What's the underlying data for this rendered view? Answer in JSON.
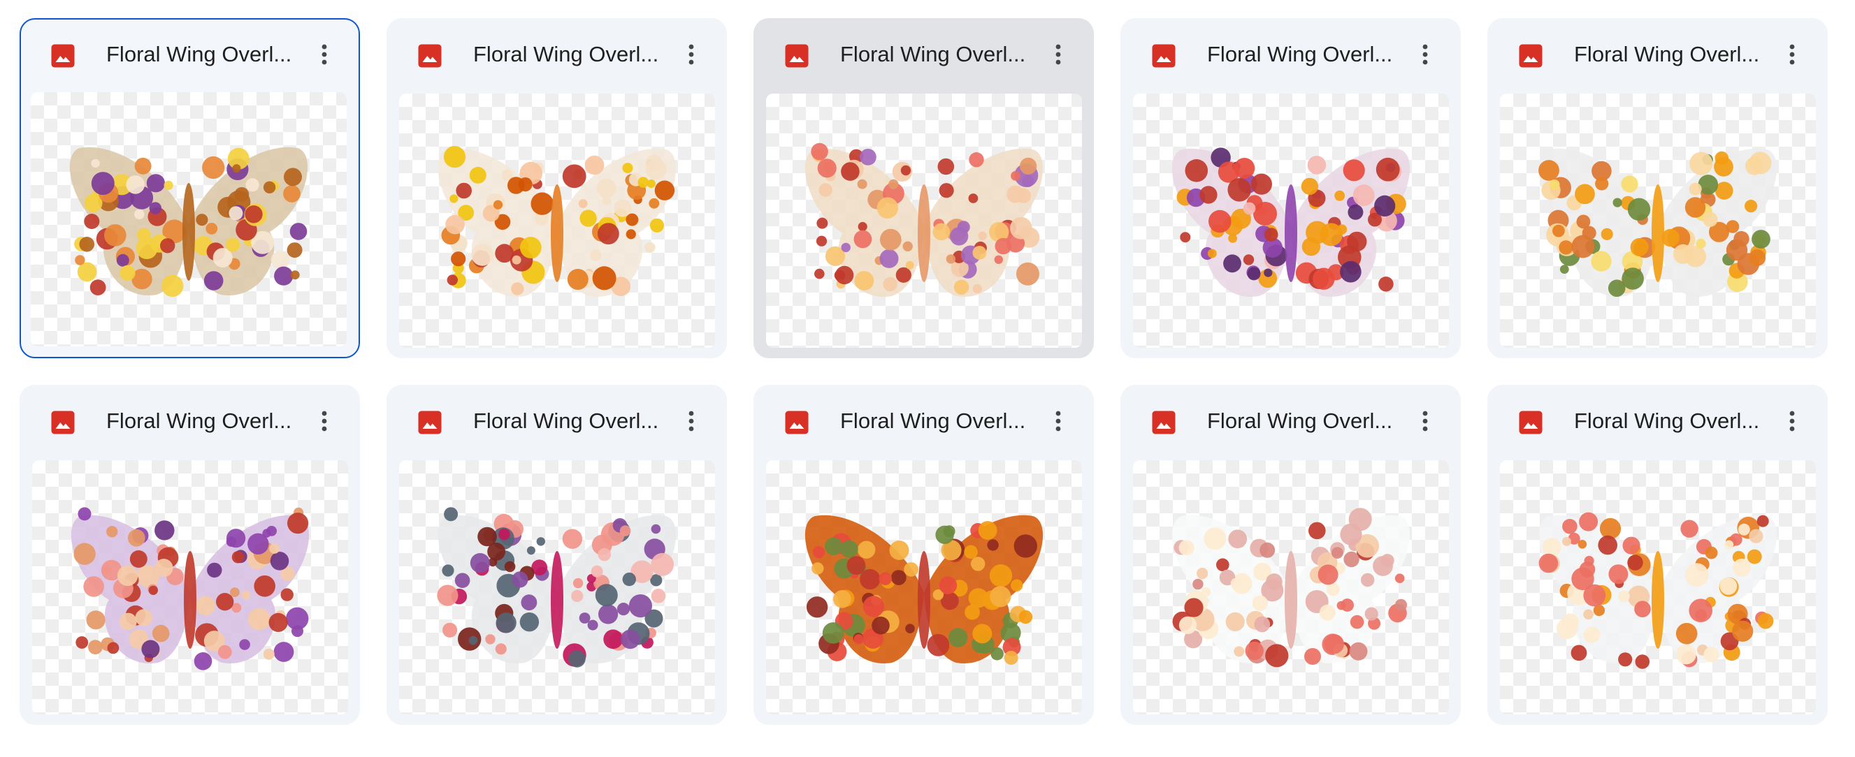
{
  "files": [
    {
      "name": "Floral Wing Overl...",
      "state": "selected",
      "petals": [
        "#b5651d",
        "#e8893a",
        "#c0392b",
        "#f4d03f",
        "#7d3c98",
        "#f5e6d3"
      ],
      "wing_tone": "#d9c6a5"
    },
    {
      "name": "Floral Wing Overl...",
      "state": "normal",
      "petals": [
        "#e67e22",
        "#c0392b",
        "#f7c59f",
        "#f1c40f",
        "#f5e1c8",
        "#d35400"
      ],
      "wing_tone": "#f2e6d8"
    },
    {
      "name": "Floral Wing Overl...",
      "state": "hovered",
      "petals": [
        "#e59866",
        "#c0392b",
        "#f8c471",
        "#f5cba7",
        "#a569bd",
        "#ec7063"
      ],
      "wing_tone": "#f0dcc4"
    },
    {
      "name": "Floral Wing Overl...",
      "state": "normal",
      "petals": [
        "#8e44ad",
        "#c0392b",
        "#e74c3c",
        "#f5b7b1",
        "#5b2c6f",
        "#f39c12"
      ],
      "wing_tone": "#e8d6e4"
    },
    {
      "name": "Floral Wing Overl...",
      "state": "normal",
      "petals": [
        "#f39c12",
        "#e67e22",
        "#f7dc6f",
        "#dc7633",
        "#fad7a0",
        "#6e8b3d"
      ],
      "wing_tone": "#ececec"
    },
    {
      "name": "Floral Wing Overl...",
      "state": "normal",
      "petals": [
        "#c0392b",
        "#8e44ad",
        "#f1948a",
        "#e59866",
        "#f5cba7",
        "#6c3483"
      ],
      "wing_tone": "#d7bde2"
    },
    {
      "name": "Floral Wing Overl...",
      "state": "normal",
      "petals": [
        "#c2185b",
        "#884ea0",
        "#f1948a",
        "#566573",
        "#f5b7b1",
        "#7b241c"
      ],
      "wing_tone": "#e5e7e9"
    },
    {
      "name": "Floral Wing Overl...",
      "state": "normal",
      "petals": [
        "#c0392b",
        "#e74c3c",
        "#f39c12",
        "#922b21",
        "#f5b041",
        "#6e8b3d"
      ],
      "wing_tone": "#d35400"
    },
    {
      "name": "Floral Wing Overl...",
      "state": "normal",
      "petals": [
        "#e6b0aa",
        "#c0392b",
        "#f5cba7",
        "#ec7063",
        "#fdebd0",
        "#d98880"
      ],
      "wing_tone": "#f8f9f9"
    },
    {
      "name": "Floral Wing Overl...",
      "state": "normal",
      "petals": [
        "#f39c12",
        "#f5cba7",
        "#e67e22",
        "#ec7063",
        "#fdebd0",
        "#c0392b"
      ],
      "wing_tone": "#f2f3f4"
    }
  ],
  "icons": {
    "file_type": "image-file-icon",
    "menu": "more-vertical-icon"
  },
  "colors": {
    "image_icon": "#d93025",
    "selected_border": "#0b57d0",
    "card_bg": "#f1f4f9",
    "hover_bg": "#e1e3e6"
  }
}
